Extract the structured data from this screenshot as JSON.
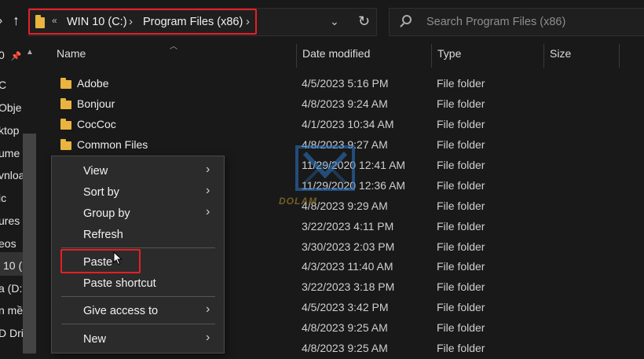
{
  "address": {
    "breadcrumbs": [
      "WIN 10 (C:)",
      "Program Files (x86)"
    ],
    "overflow": "«"
  },
  "search": {
    "placeholder": "Search Program Files (x86)"
  },
  "nav_pane": {
    "items": [
      "C",
      "Obje",
      "ktop",
      "ume",
      "vnloa",
      "ic",
      "ures",
      "eos",
      "10 (",
      "a (D:",
      "n mề",
      "D Driv"
    ],
    "pinned_prefix": "0"
  },
  "columns": [
    "Name",
    "Date modified",
    "Type",
    "Size"
  ],
  "files": [
    {
      "name": "Adobe",
      "date": "4/5/2023 5:16 PM",
      "type": "File folder"
    },
    {
      "name": "Bonjour",
      "date": "4/8/2023 9:24 AM",
      "type": "File folder"
    },
    {
      "name": "CocCoc",
      "date": "4/1/2023 10:34 AM",
      "type": "File folder"
    },
    {
      "name": "Common Files",
      "date": "4/8/2023 9:27 AM",
      "type": "File folder"
    },
    {
      "name": "",
      "date": "11/29/2020 12:41 AM",
      "type": "File folder"
    },
    {
      "name": "",
      "date": "11/29/2020 12:36 AM",
      "type": "File folder"
    },
    {
      "name": "",
      "date": "4/8/2023 9:29 AM",
      "type": "File folder"
    },
    {
      "name": "",
      "date": "3/22/2023 4:11 PM",
      "type": "File folder"
    },
    {
      "name": "",
      "date": "3/30/2023 2:03 PM",
      "type": "File folder"
    },
    {
      "name": "",
      "date": "4/3/2023 11:40 AM",
      "type": "File folder"
    },
    {
      "name": "",
      "date": "3/22/2023 3:18 PM",
      "type": "File folder"
    },
    {
      "name": "",
      "date": "4/5/2023 3:42 PM",
      "type": "File folder"
    },
    {
      "name": "",
      "date": "4/8/2023 9:25 AM",
      "type": "File folder"
    },
    {
      "name": "",
      "date": "4/8/2023 9:25 AM",
      "type": "File folder"
    }
  ],
  "context_menu": {
    "view": "View",
    "sort_by": "Sort by",
    "group_by": "Group by",
    "refresh": "Refresh",
    "paste": "Paste",
    "paste_shortcut": "Paste shortcut",
    "give_access": "Give access to",
    "new": "New"
  },
  "watermark": {
    "text": "DOLAM"
  },
  "colors": {
    "highlight": "#e81e25",
    "folder": "#e9b43f",
    "background": "#191919"
  }
}
